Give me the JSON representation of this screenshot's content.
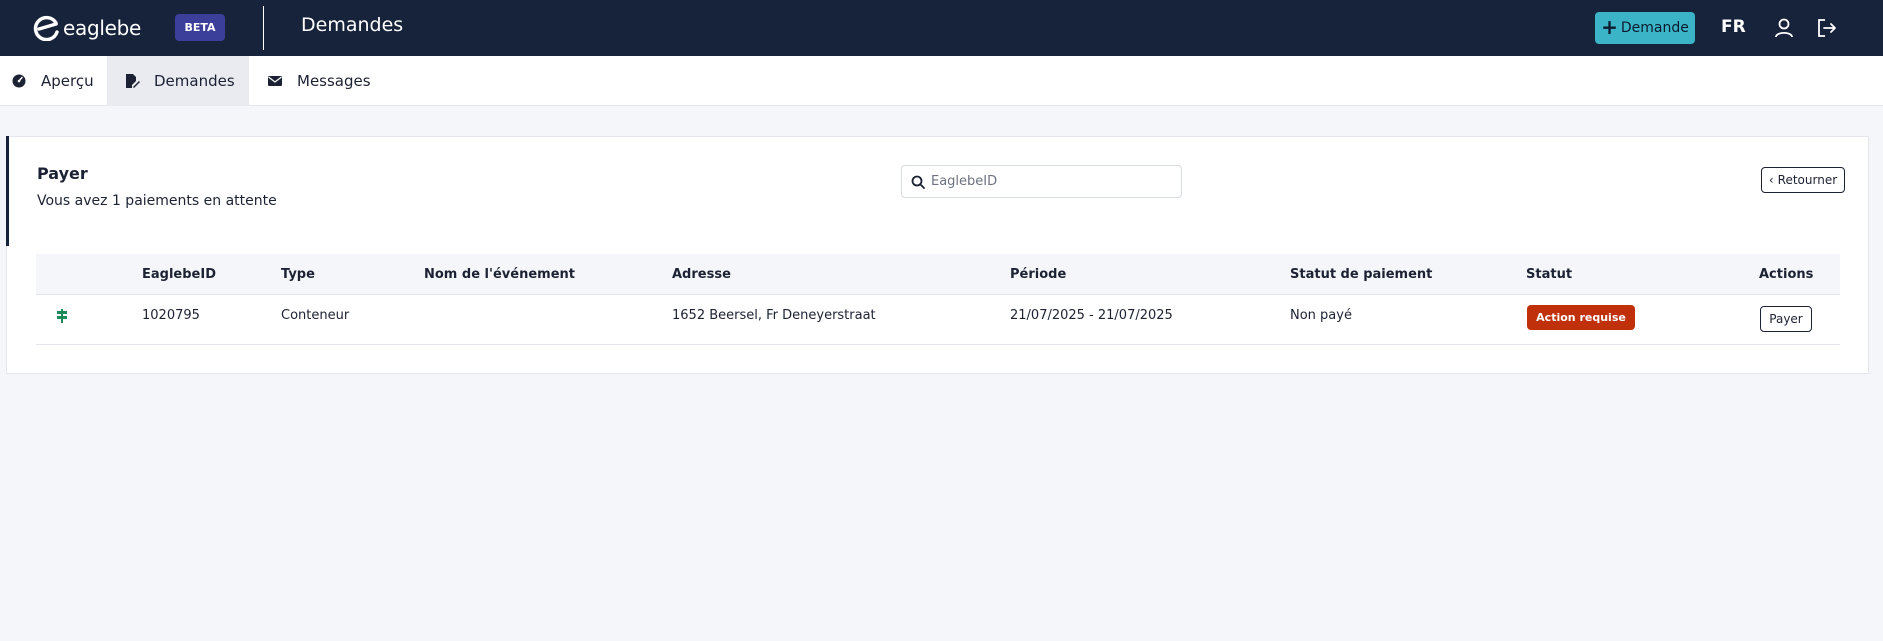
{
  "header": {
    "logo_text": "eaglebe",
    "beta_label": "BETA",
    "title": "Demandes",
    "new_button_label": "Demande",
    "language": "FR",
    "icons": [
      "user-icon",
      "logout-icon"
    ],
    "background_color": "#17223b",
    "accent_color": "#3ab4c6"
  },
  "tabs": [
    {
      "label": "Aperçu",
      "icon": "dashboard-icon",
      "active": false
    },
    {
      "label": "Demandes",
      "icon": "edit-document-icon",
      "active": true
    },
    {
      "label": "Messages",
      "icon": "envelope-icon",
      "active": false
    }
  ],
  "card": {
    "title": "Payer",
    "subtitle": "Vous avez 1 paiements en attente",
    "search_placeholder": "EaglebeID",
    "back_label": "Retourner"
  },
  "table": {
    "columns": [
      "",
      "EaglebeID",
      "Type",
      "Nom de l'événement",
      "Adresse",
      "Période",
      "Statut de paiement",
      "Statut",
      "Actions"
    ],
    "rows": [
      {
        "icon": "signpost-icon",
        "id": "1020795",
        "type": "Conteneur",
        "event_name": "",
        "address": "1652 Beersel, Fr Deneyerstraat",
        "period": "21/07/2025 - 21/07/2025",
        "payment_status": "Non payé",
        "status": "Action requise",
        "action": "Payer"
      }
    ],
    "status_color": "#c0300b"
  }
}
